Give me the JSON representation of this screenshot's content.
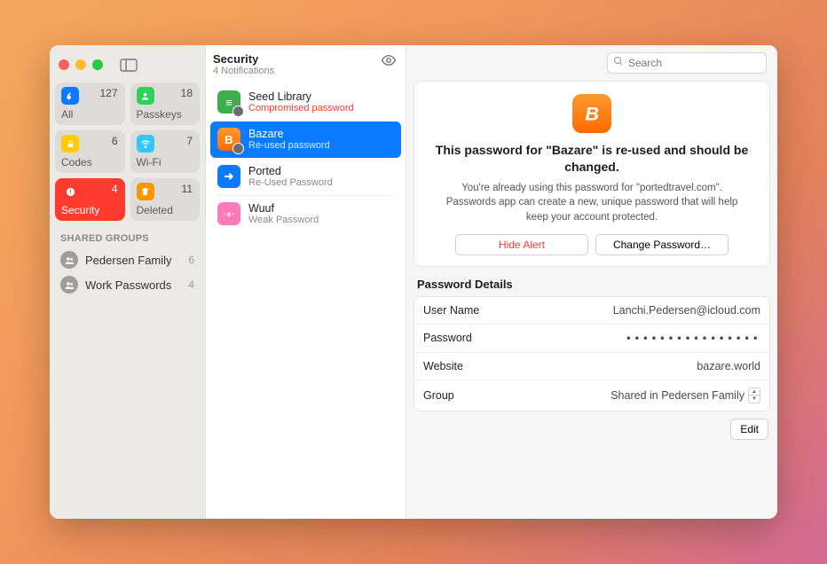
{
  "sidebar": {
    "tiles": [
      {
        "id": "all",
        "label": "All",
        "count": "127",
        "color": "#0a7aff",
        "icon": "key"
      },
      {
        "id": "passkeys",
        "label": "Passkeys",
        "count": "18",
        "color": "#30d158",
        "icon": "person"
      },
      {
        "id": "codes",
        "label": "Codes",
        "count": "6",
        "color": "#ffcc00",
        "icon": "lock"
      },
      {
        "id": "wifi",
        "label": "Wi-Fi",
        "count": "7",
        "color": "#34c6ff",
        "icon": "wifi"
      },
      {
        "id": "security",
        "label": "Security",
        "count": "4",
        "color": "#ff3b30",
        "icon": "alert",
        "active": true
      },
      {
        "id": "deleted",
        "label": "Deleted",
        "count": "11",
        "color": "#ff9500",
        "icon": "trash"
      }
    ],
    "shared_label": "SHARED GROUPS",
    "groups": [
      {
        "name": "Pedersen Family",
        "count": "6"
      },
      {
        "name": "Work Passwords",
        "count": "4"
      }
    ]
  },
  "middle": {
    "title": "Security",
    "subtitle": "4 Notifications",
    "items": [
      {
        "name": "Seed Library",
        "sub": "Compromised password",
        "sub_red": true,
        "icon_bg": "#3cb04a",
        "icon_txt": "≡",
        "badge": true
      },
      {
        "name": "Bazare",
        "sub": "Re-used password",
        "icon_bg": "linear-gradient(180deg,#ff9a2e,#ff6a00)",
        "icon_txt": "B",
        "badge": true,
        "selected": true
      },
      {
        "name": "Ported",
        "sub": "Re-Used Password",
        "icon_bg": "#0a7aff",
        "icon_txt": "➜"
      },
      {
        "name": "Wuuf",
        "sub": "Weak Password",
        "icon_bg": "#ff7ab8",
        "icon_txt": "･ᴥ･"
      }
    ]
  },
  "detail": {
    "search_placeholder": "Search",
    "alert_title": "This password for \"Bazare\" is re-used and should be changed.",
    "alert_body": "You're already using this password for \"portedtravel.com\". Passwords app can create a new, unique password that will help keep your account protected.",
    "hide_btn": "Hide Alert",
    "change_btn": "Change Password…",
    "details_title": "Password Details",
    "rows": {
      "username_label": "User Name",
      "username": "Lanchi.Pedersen@icloud.com",
      "password_label": "Password",
      "password": "••••••••••••••••",
      "website_label": "Website",
      "website": "bazare.world",
      "group_label": "Group",
      "group": "Shared in Pedersen Family"
    },
    "edit_btn": "Edit"
  }
}
